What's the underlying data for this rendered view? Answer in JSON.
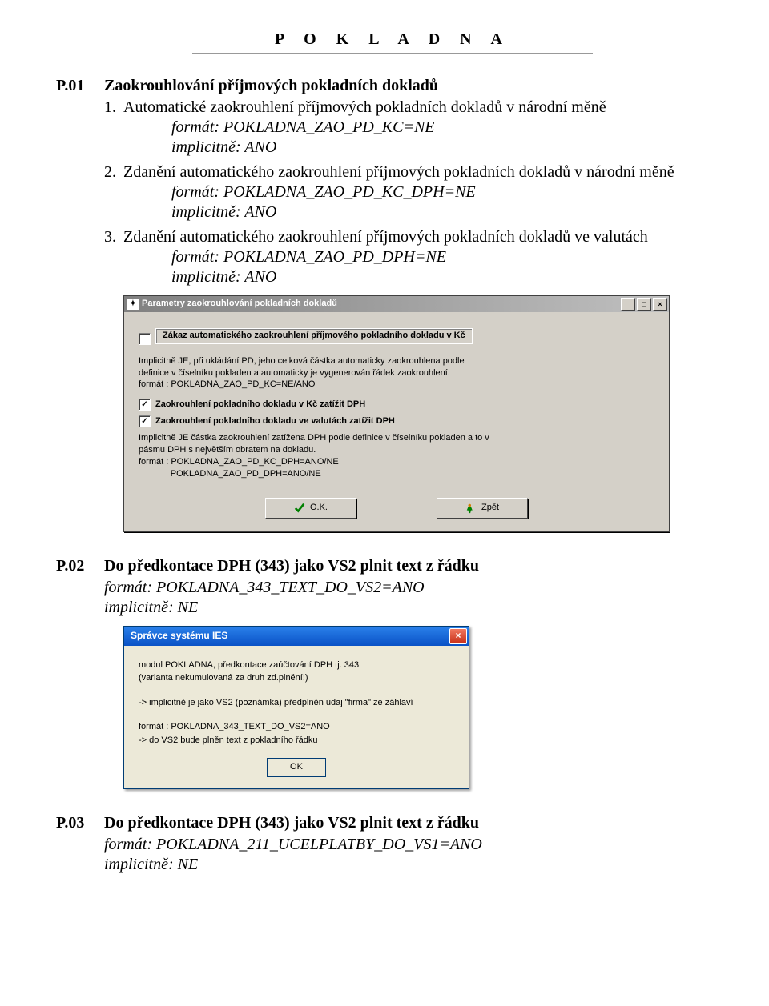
{
  "page": {
    "title_spaced": "P O K L A D N A"
  },
  "sections": {
    "p01": {
      "num": "P.01",
      "title": "Zaokrouhlování příjmových pokladních dokladů",
      "items": [
        {
          "n": "1.",
          "text": "Automatické zaokrouhlení příjmových pokladních dokladů v národní měně",
          "format": "formát: POKLADNA_ZAO_PD_KC=NE",
          "default": "implicitně: ANO"
        },
        {
          "n": "2.",
          "text": "Zdanění automatického zaokrouhlení příjmových pokladních dokladů v národní měně",
          "format": "formát: POKLADNA_ZAO_PD_KC_DPH=NE",
          "default": "implicitně: ANO"
        },
        {
          "n": "3.",
          "text": "Zdanění automatického zaokrouhlení příjmových pokladních dokladů ve valutách",
          "format": "formát: POKLADNA_ZAO_PD_DPH=NE",
          "default": "implicitně: ANO"
        }
      ]
    },
    "p02": {
      "num": "P.02",
      "title": "Do předkontace DPH (343) jako VS2 plnit text z řádku",
      "format": "formát: POKLADNA_343_TEXT_DO_VS2=ANO",
      "default": "implicitně: NE"
    },
    "p03": {
      "num": "P.03",
      "title": "Do předkontace DPH (343) jako VS2 plnit text z řádku",
      "format": "formát: POKLADNA_211_UCELPLATBY_DO_VS1=ANO",
      "default": "implicitně: NE"
    }
  },
  "dialog1": {
    "title": "Parametry zaokrouhlování pokladních dokladů",
    "group1_chk_checked": false,
    "group1_label": "Zákaz automatického zaokrouhlení příjmového pokladního dokladu v Kč",
    "help1_line1": "Implicitně JE, při ukládání PD, jeho celková částka automaticky zaokrouhlena podle",
    "help1_line2": "definice v číselníku pokladen a automaticky je vygenerován řádek zaokrouhlení.",
    "help1_line3": "formát : POKLADNA_ZAO_PD_KC=NE/ANO",
    "chk2_checked": true,
    "chk2_label": "Zaokrouhlení pokladního dokladu v Kč zatížit DPH",
    "chk3_checked": true,
    "chk3_label": "Zaokrouhlení pokladního dokladu ve valutách zatížit DPH",
    "help2_line1": "Implicitně JE částka zaokrouhlení zatížena DPH podle definice v číselníku pokladen a to v",
    "help2_line2": "pásmu DPH s největším obratem na dokladu.",
    "help2_line3": "formát : POKLADNA_ZAO_PD_KC_DPH=ANO/NE",
    "help2_line4": "             POKLADNA_ZAO_PD_DPH=ANO/NE",
    "btn_ok": "O.K.",
    "btn_back": "Zpět",
    "titlebar_icon_glyph": "✦"
  },
  "dialog2": {
    "title": "Správce systému IES",
    "line1": "modul POKLADNA, předkontace zaúčtování DPH tj. 343",
    "line2": "(varianta nekumulovaná za druh zd.plnění!)",
    "line3": "-> implicitně je jako VS2 (poznámka) předplněn údaj \"firma\" ze záhlaví",
    "line4": "formát : POKLADNA_343_TEXT_DO_VS2=ANO",
    "line5": "-> do VS2 bude plněn text z pokladního řádku",
    "btn_ok": "OK"
  }
}
